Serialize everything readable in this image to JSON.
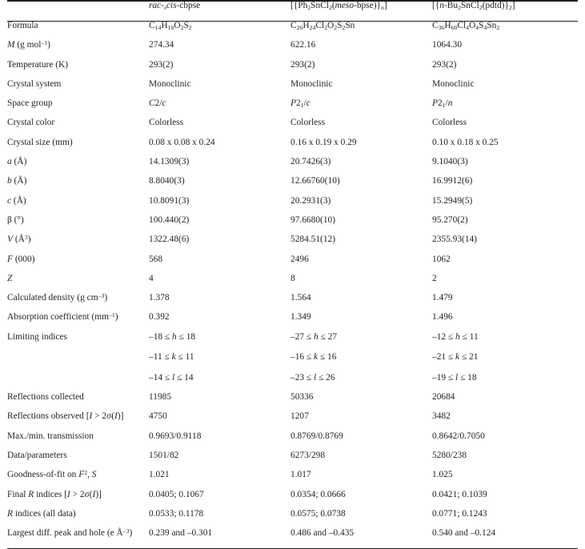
{
  "table": {
    "columns": [
      {
        "id": "label",
        "header": ""
      },
      {
        "id": "col1",
        "header_html": "<span class=\"i\">rac</span>-,<span class=\"i\">cis</span>-cbpse",
        "header_text": "rac-,cis-cbpse"
      },
      {
        "id": "col2",
        "header_html": "[{Ph<sub>2</sub>SnCl<sub>2</sub>(<span class=\"i\">meso</span>-bpse)}<sub><span class=\"i\">n</span></sub>]",
        "header_text": "[{Ph2SnCl2(meso-bpse)}n]"
      },
      {
        "id": "col3",
        "header_html": "[{<span class=\"i\">n</span>-Bu<sub>2</sub>SnCl<sub>2</sub>(pdtd)}<sub>2</sub>]",
        "header_text": "[{n-Bu2SnCl2(pdtd)}2]"
      }
    ],
    "rows": [
      {
        "label_html": "Formula",
        "label_text": "Formula",
        "values_html": [
          "C<sub>14</sub>H<sub>10</sub>O<sub>2</sub>S<sub>2</sub>",
          "C<sub>26</sub>H<sub>24</sub>Cl<sub>2</sub>O<sub>2</sub>S<sub>2</sub>Sn",
          "C<sub>36</sub>H<sub>60</sub>Cl<sub>4</sub>O<sub>4</sub>S<sub>4</sub>Sn<sub>2</sub>"
        ],
        "values_text": [
          "C14H10O2S2",
          "C26H24Cl2O2S2Sn",
          "C36H60Cl4O4S4Sn2"
        ]
      },
      {
        "label_html": "<span class=\"i\">M</span> (g mol<sup>–1</sup>)",
        "label_text": "M (g mol-1)",
        "values_html": [
          "274.34",
          "622.16",
          "1064.30"
        ],
        "values_text": [
          "274.34",
          "622.16",
          "1064.30"
        ]
      },
      {
        "label_html": "Temperature (K)",
        "label_text": "Temperature (K)",
        "values_html": [
          "293(2)",
          "293(2)",
          "293(2)"
        ],
        "values_text": [
          "293(2)",
          "293(2)",
          "293(2)"
        ]
      },
      {
        "label_html": "Crystal system",
        "label_text": "Crystal system",
        "values_html": [
          "Monoclinic",
          "Monoclinic",
          "Monoclinic"
        ],
        "values_text": [
          "Monoclinic",
          "Monoclinic",
          "Monoclinic"
        ]
      },
      {
        "label_html": "Space group",
        "label_text": "Space group",
        "values_html": [
          "<span class=\"i\">C</span>2/<span class=\"i\">c</span>",
          "<span class=\"i\">P</span>2<sub>1</sub>/<span class=\"i\">c</span>",
          "<span class=\"i\">P</span>2<sub>1</sub>/<span class=\"i\">n</span>"
        ],
        "values_text": [
          "C2/c",
          "P21/c",
          "P21/n"
        ]
      },
      {
        "label_html": "Crystal color",
        "label_text": "Crystal color",
        "values_html": [
          "Colorless",
          "Colorless",
          "Colorless"
        ],
        "values_text": [
          "Colorless",
          "Colorless",
          "Colorless"
        ]
      },
      {
        "label_html": "Crystal size (mm)",
        "label_text": "Crystal size (mm)",
        "values_html": [
          "0.08 x 0.08 x 0.24",
          "0.16 x 0.19 x 0.29",
          "0.10 x 0.18 x 0.25"
        ],
        "values_text": [
          "0.08 x 0.08 x 0.24",
          "0.16 x 0.19 x 0.29",
          "0.10 x 0.18 x 0.25"
        ]
      },
      {
        "label_html": "<span class=\"i\">a</span> (Å)",
        "label_text": "a (A)",
        "values_html": [
          "14.1309(3)",
          "20.7426(3)",
          "9.1040(3)"
        ],
        "values_text": [
          "14.1309(3)",
          "20.7426(3)",
          "9.1040(3)"
        ]
      },
      {
        "label_html": "<span class=\"i\">b</span> (Å)",
        "label_text": "b (A)",
        "values_html": [
          "8.8040(3)",
          "12.66760(10)",
          "16.9912(6)"
        ],
        "values_text": [
          "8.8040(3)",
          "12.66760(10)",
          "16.9912(6)"
        ]
      },
      {
        "label_html": "<span class=\"i\">c</span> (Å)",
        "label_text": "c (A)",
        "values_html": [
          "10.8091(3)",
          "20.2931(3)",
          "15.2949(5)"
        ],
        "values_text": [
          "10.8091(3)",
          "20.2931(3)",
          "15.2949(5)"
        ]
      },
      {
        "label_html": "β (°)",
        "label_text": "beta (deg)",
        "values_html": [
          "100.440(2)",
          "97.6680(10)",
          "95.270(2)"
        ],
        "values_text": [
          "100.440(2)",
          "97.6680(10)",
          "95.270(2)"
        ]
      },
      {
        "label_html": "<span class=\"i\">V</span> (Å<sup>3</sup>)",
        "label_text": "V (A3)",
        "values_html": [
          "1322.48(6)",
          "5284.51(12)",
          "2355.93(14)"
        ],
        "values_text": [
          "1322.48(6)",
          "5284.51(12)",
          "2355.93(14)"
        ]
      },
      {
        "label_html": "<span class=\"i\">F</span> (000)",
        "label_text": "F (000)",
        "values_html": [
          "568",
          "2496",
          "1062"
        ],
        "values_text": [
          "568",
          "2496",
          "1062"
        ]
      },
      {
        "label_html": "<span class=\"i\">Z</span>",
        "label_text": "Z",
        "values_html": [
          "4",
          "8",
          "2"
        ],
        "values_text": [
          "4",
          "8",
          "2"
        ]
      },
      {
        "label_html": "Calculated density (g cm<sup>–3</sup>)",
        "label_text": "Calculated density (g cm-3)",
        "values_html": [
          "1.378",
          "1.564",
          "1.479"
        ],
        "values_text": [
          "1.378",
          "1.564",
          "1.479"
        ]
      },
      {
        "label_html": "Absorption coefficient (mm<sup>–1</sup>)",
        "label_text": "Absorption coefficient (mm-1)",
        "values_html": [
          "0.392",
          "1.349",
          "1.496"
        ],
        "values_text": [
          "0.392",
          "1.349",
          "1.496"
        ]
      },
      {
        "label_html": "Limiting indices",
        "label_text": "Limiting indices",
        "values_html": [
          "–18 ≤ <span class=\"i\">h</span> ≤ 18",
          "–27 ≤ <span class=\"i\">h</span> ≤ 27",
          "–12 ≤ <span class=\"i\">h</span> ≤ 11"
        ],
        "values_text": [
          "-18 <= h <= 18",
          "-27 <= h <= 27",
          "-12 <= h <= 11"
        ]
      },
      {
        "label_html": "",
        "label_text": "",
        "continuation": true,
        "values_html": [
          "–11 ≤ <span class=\"i\">k</span> ≤ 11",
          "–16 ≤ <span class=\"i\">k</span> ≤ 16",
          "–21 ≤ <span class=\"i\">k</span> ≤ 21"
        ],
        "values_text": [
          "-11 <= k <= 11",
          "-16 <= k <= 16",
          "-21 <= k <= 21"
        ]
      },
      {
        "label_html": "",
        "label_text": "",
        "continuation": true,
        "values_html": [
          "–14 ≤ <span class=\"i\">l</span> ≤ 14",
          "–23 ≤ <span class=\"i\">l</span> ≤ 26",
          "–19 ≤ <span class=\"i\">l</span> ≤ 18"
        ],
        "values_text": [
          "-14 <= l <= 14",
          "-23 <= l <= 26",
          "-19 <= l <= 18"
        ]
      },
      {
        "label_html": "Reflections collected",
        "label_text": "Reflections collected",
        "values_html": [
          "11985",
          "50336",
          "20684"
        ],
        "values_text": [
          "11985",
          "50336",
          "20684"
        ]
      },
      {
        "label_html": "Reflections observed [<span class=\"i\">I</span> &gt; 2σ(<span class=\"i\">I</span>)]",
        "label_text": "Reflections observed [I > 2sigma(I)]",
        "values_html": [
          "4750",
          "1207",
          "3482"
        ],
        "values_text": [
          "4750",
          "1207",
          "3482"
        ]
      },
      {
        "label_html": "Max./min. transmission",
        "label_text": "Max./min. transmission",
        "values_html": [
          "0.9693/0.9118",
          "0.8769/0.8769",
          "0.8642/0.7050"
        ],
        "values_text": [
          "0.9693/0.9118",
          "0.8769/0.8769",
          "0.8642/0.7050"
        ]
      },
      {
        "label_html": "Data/parameters",
        "label_text": "Data/parameters",
        "values_html": [
          "1501/82",
          "6273/298",
          "5280/238"
        ],
        "values_text": [
          "1501/82",
          "6273/298",
          "5280/238"
        ]
      },
      {
        "label_html": "Goodness-of-fit on <span class=\"i\">F</span><sup>2</sup>, <span class=\"i\">S</span>",
        "label_text": "Goodness-of-fit on F2, S",
        "values_html": [
          "1.021",
          "1.017",
          "1.025"
        ],
        "values_text": [
          "1.021",
          "1.017",
          "1.025"
        ]
      },
      {
        "label_html": "Final <span class=\"i\">R</span> indices [<span class=\"i\">I</span> &gt; 2σ(<span class=\"i\">I</span>)]",
        "label_text": "Final R indices [I > 2sigma(I)]",
        "values_html": [
          "0.0405; 0.1067",
          "0.0354; 0.0666",
          "0.0421; 0.1039"
        ],
        "values_text": [
          "0.0405; 0.1067",
          "0.0354; 0.0666",
          "0.0421; 0.1039"
        ]
      },
      {
        "label_html": "<span class=\"i\">R</span> indices (all data)",
        "label_text": "R indices (all data)",
        "values_html": [
          "0.0533; 0.1178",
          "0.0575; 0.0738",
          "0.0771; 0.1243"
        ],
        "values_text": [
          "0.0533; 0.1178",
          "0.0575; 0.0738",
          "0.0771; 0.1243"
        ]
      },
      {
        "label_html": "Largest diff. peak and hole (e Å<sup>–3</sup>)",
        "label_text": "Largest diff. peak and hole (e A-3)",
        "last": true,
        "values_html": [
          "0.239 and –0.301",
          "0.486 and –0.435",
          "0.540 and –0.124"
        ],
        "values_text": [
          "0.239 and -0.301",
          "0.486 and -0.435",
          "0.540 and -0.124"
        ]
      }
    ]
  }
}
